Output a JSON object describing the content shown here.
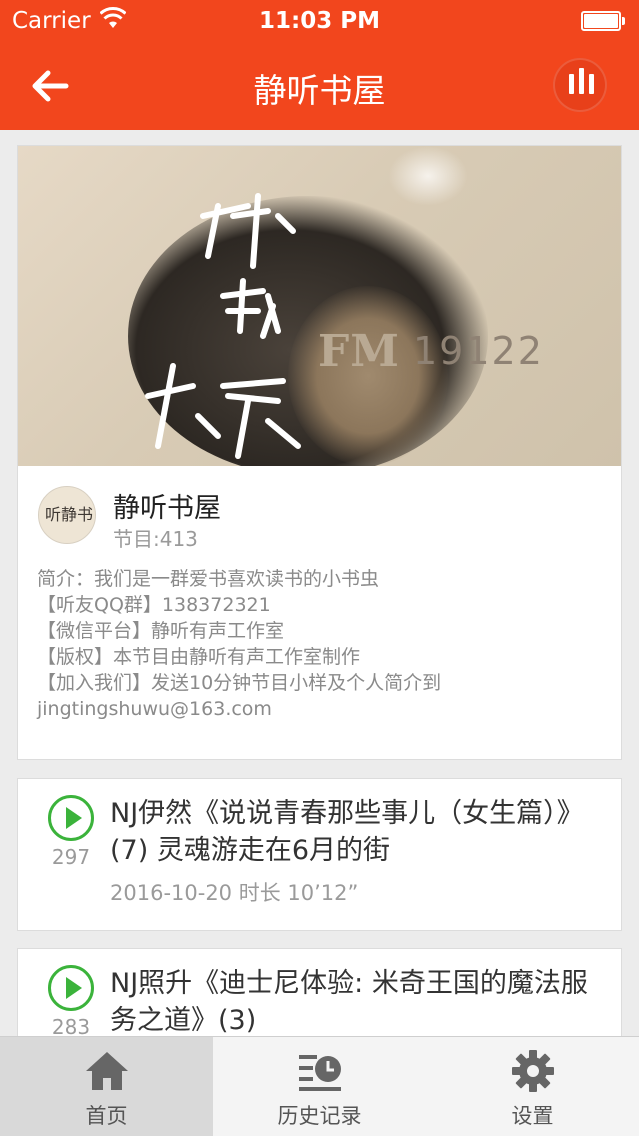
{
  "status_bar": {
    "carrier": "Carrier",
    "time": "11:03 PM"
  },
  "nav": {
    "title": "静听书屋",
    "back_icon": "arrow-left-icon",
    "player_icon": "equalizer-icon"
  },
  "channel": {
    "cover_text_fm": "FM",
    "cover_text_number": "19122",
    "name": "静听书屋",
    "program_count": "节目:413",
    "description_lines": [
      "简介：我们是一群爱书喜欢读书的小书虫",
      "【听友QQ群】138372321",
      "【微信平台】静听有声工作室",
      "【版权】本节目由静听有声工作室制作",
      "【加入我们】发送10分钟节目小样及个人简介到",
      "jingtingshuwu@163.com"
    ]
  },
  "episodes": [
    {
      "title": "NJ伊然《说说青春那些事儿（女生篇）》(7) 灵魂游走在6月的街",
      "play_count": "297",
      "meta": "2016-10-20  时长 10’12”"
    },
    {
      "title": "NJ照升《迪士尼体验: 米奇王国的魔法服务之道》(3)",
      "play_count": "283"
    }
  ],
  "tabbar": {
    "home": "首页",
    "history": "历史记录",
    "settings": "设置"
  },
  "colors": {
    "accent": "#f2461d",
    "play_green": "#3bb33b"
  }
}
